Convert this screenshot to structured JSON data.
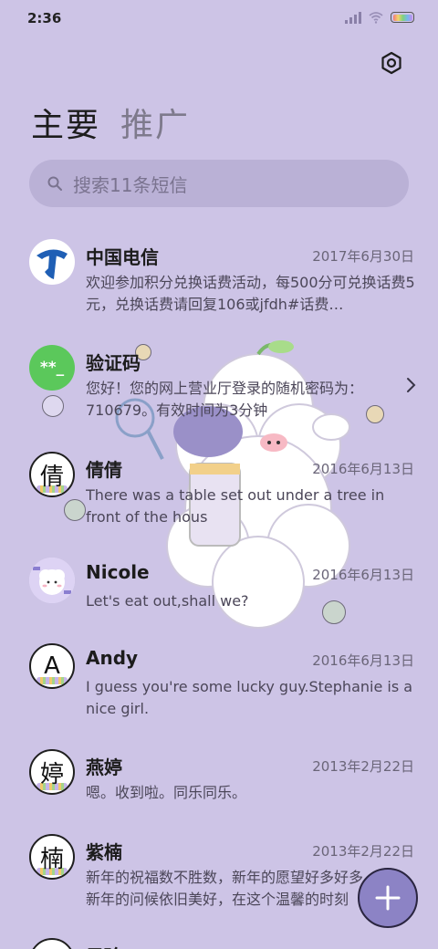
{
  "status_bar": {
    "time": "2:36"
  },
  "tabs": [
    {
      "label": "主要",
      "active": true
    },
    {
      "label": "推广",
      "active": false
    }
  ],
  "search": {
    "placeholder": "搜索11条短信"
  },
  "threads": [
    {
      "name": "中国电信",
      "date": "2017年6月30日",
      "snippet": "欢迎参加积分兑换话费活动，每500分可兑换话费5元，兑换话费请回复106或jfdh#话费…",
      "avatar_icon": "china-telecom-logo-icon"
    },
    {
      "name": "验证码",
      "date": "",
      "snippet": "您好！您的网上营业厅登录的随机密码为：710679。有效时间为3分钟",
      "avatar_icon": "verification-code-icon",
      "avatar_text": "**_"
    },
    {
      "name": "倩倩",
      "date": "2016年6月13日",
      "snippet": "There was a table set out under a tree in front of the hous",
      "avatar_letter": "倩"
    },
    {
      "name": "Nicole",
      "date": "2016年6月13日",
      "snippet": "Let's eat out,shall we?",
      "avatar_icon": "cartoon-sheep-avatar-icon"
    },
    {
      "name": "Andy",
      "date": "2016年6月13日",
      "snippet": "I guess you're some lucky guy.Stephanie is a nice girl.",
      "avatar_letter": "A"
    },
    {
      "name": "燕婷",
      "date": "2013年2月22日",
      "snippet": "嗯。收到啦。同乐同乐。",
      "avatar_letter": "婷"
    },
    {
      "name": "紫楠",
      "date": "2013年2月22日",
      "snippet": "新年的祝福数不胜数，新年的愿望好多好多，新年的问候依旧美好，在这个温馨的时刻",
      "avatar_letter": "楠"
    },
    {
      "name": "子玲",
      "date": "",
      "snippet": "",
      "avatar_letter": ""
    }
  ],
  "colors": {
    "background": "#cdc4e6",
    "search_bg": "#bab1d6",
    "fab": "#8c83c5",
    "telecom_blue": "#1f5fb5",
    "verify_green": "#5bc85b"
  },
  "icons": {
    "settings": "gear-icon",
    "search": "search-icon",
    "fab": "plus-icon",
    "chevron": "chevron-right-icon"
  }
}
